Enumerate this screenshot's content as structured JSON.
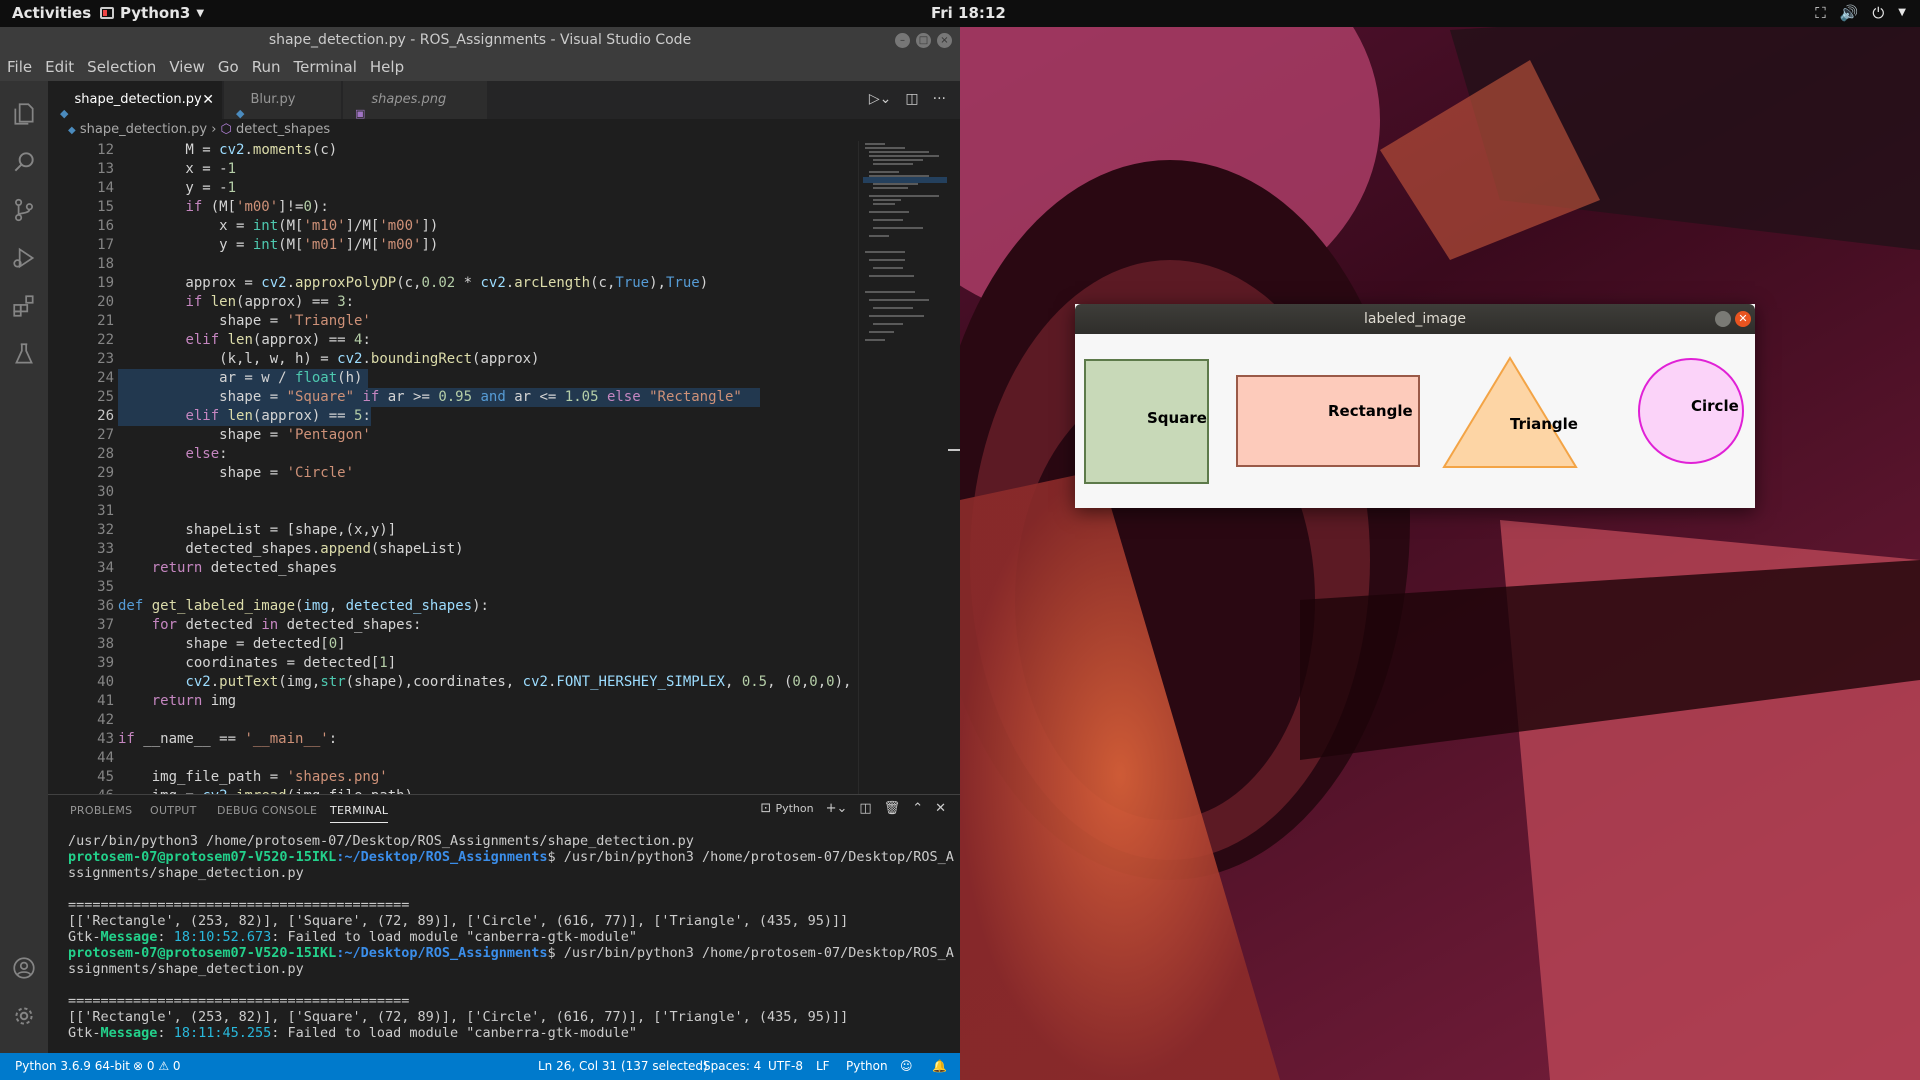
{
  "topbar": {
    "activities": "Activities",
    "app": "Python3",
    "clock": "Fri 18:12"
  },
  "vscode": {
    "window_title": "shape_detection.py - ROS_Assignments - Visual Studio Code",
    "menu": [
      "File",
      "Edit",
      "Selection",
      "View",
      "Go",
      "Run",
      "Terminal",
      "Help"
    ],
    "tabs": [
      {
        "label": "shape_detection.py",
        "active": true
      },
      {
        "label": "Blur.py",
        "active": false
      },
      {
        "label": "shapes.png",
        "active": false
      }
    ],
    "breadcrumb": {
      "file": "shape_detection.py",
      "symbol": "detect_shapes"
    },
    "line_numbers": [
      "12",
      "13",
      "14",
      "15",
      "16",
      "17",
      "18",
      "19",
      "20",
      "21",
      "22",
      "23",
      "24",
      "25",
      "26",
      "27",
      "28",
      "29",
      "30",
      "31",
      "32",
      "33",
      "34",
      "35",
      "36",
      "37",
      "38",
      "39",
      "40",
      "41",
      "42",
      "43",
      "44",
      "45",
      "46"
    ],
    "current_line": "26",
    "panel": {
      "tabs": [
        "PROBLEMS",
        "OUTPUT",
        "DEBUG CONSOLE",
        "TERMINAL"
      ],
      "active_tab": "TERMINAL",
      "shell": "Python"
    },
    "terminal": {
      "line1": "/usr/bin/python3 /home/protosem-07/Desktop/ROS_Assignments/shape_detection.py",
      "prompt_user": "protosem-07@protosem07-V520-15IKL",
      "prompt_path": ":~/Desktop/ROS_Assignments",
      "prompt_cmd": "$ /usr/bin/python3 /home/protosem-07/Desktop/ROS_A",
      "prompt_cont": "ssignments/shape_detection.py",
      "rule": "==========================================",
      "result": "[['Rectangle', (253, 82)], ['Square', (72, 89)], ['Circle', (616, 77)], ['Triangle', (435, 95)]]",
      "gtk_prefix": "Gtk-",
      "gtk_msg_label": "Message",
      "gtk_time1": "18:10:52.673",
      "gtk_time2": "18:11:45.255",
      "gtk_text": ": Failed to load module \"canberra-gtk-module\""
    },
    "statusbar": {
      "interpreter": "Python 3.6.9 64-bit",
      "problems": "⊗ 0 ⚠ 0",
      "position": "Ln 26, Col 31 (137 selected)",
      "spaces": "Spaces: 4",
      "encoding": "UTF-8",
      "eol": "LF",
      "language": "Python"
    }
  },
  "image_window": {
    "title": "labeled_image",
    "labels": {
      "square": "Square",
      "rectangle": "Rectangle",
      "triangle": "Triangle",
      "circle": "Circle"
    },
    "colors": {
      "square_fill": "#c8d9b8",
      "rectangle_fill": "#fdcbbb",
      "triangle_fill": "#fdd5a5",
      "circle_fill": "#fbd3f9"
    }
  }
}
